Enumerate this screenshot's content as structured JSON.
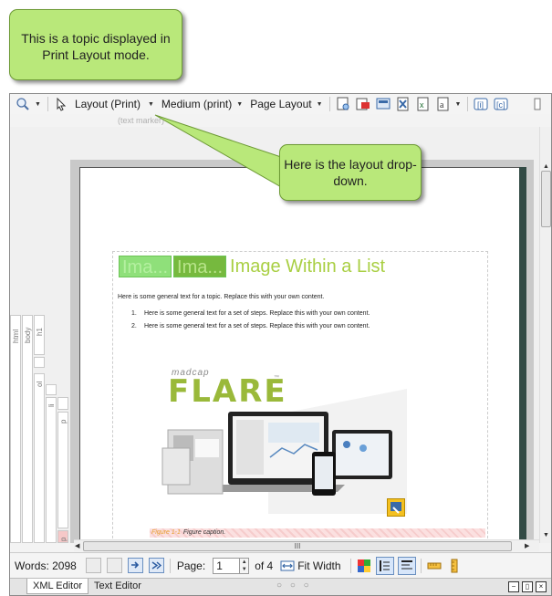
{
  "callouts": {
    "topic_note": "This is a topic displayed in Print Layout mode.",
    "layout_note": "Here is the layout drop-down."
  },
  "toolbar": {
    "layout_dropdown": "Layout (Print)",
    "medium_dropdown": "Medium (print)",
    "page_layout_dropdown": "Page Layout",
    "tag_hint": "(text marker)"
  },
  "structure_bars": [
    "html",
    "body",
    "h1",
    "ol",
    "li",
    "p",
    "p"
  ],
  "document": {
    "heading_var1": "Ima...",
    "heading_var2": "Ima...",
    "heading": "Image Within a List",
    "intro": "Here is some general text for a topic. Replace this with your own content.",
    "steps": [
      {
        "num": "1.",
        "text": "Here is some general text for a set of steps. Replace this with your own content."
      },
      {
        "num": "2.",
        "text": "Here is some general text for a set of steps. Replace this with your own content."
      }
    ],
    "image": {
      "brand_small": "madcap",
      "brand": "FLARE",
      "trademark": "™"
    },
    "caption_number": "Figure 1-1",
    "caption_text": "Figure caption."
  },
  "hscroll_grip": "III",
  "statusbar": {
    "words": "Words: 2098",
    "page_label": "Page:",
    "page_value": "1",
    "page_total": "of 4",
    "fit_width": "Fit Width"
  },
  "tabs": {
    "xml_editor": "XML Editor",
    "text_editor": "Text Editor",
    "dots": "○ ○ ○"
  }
}
